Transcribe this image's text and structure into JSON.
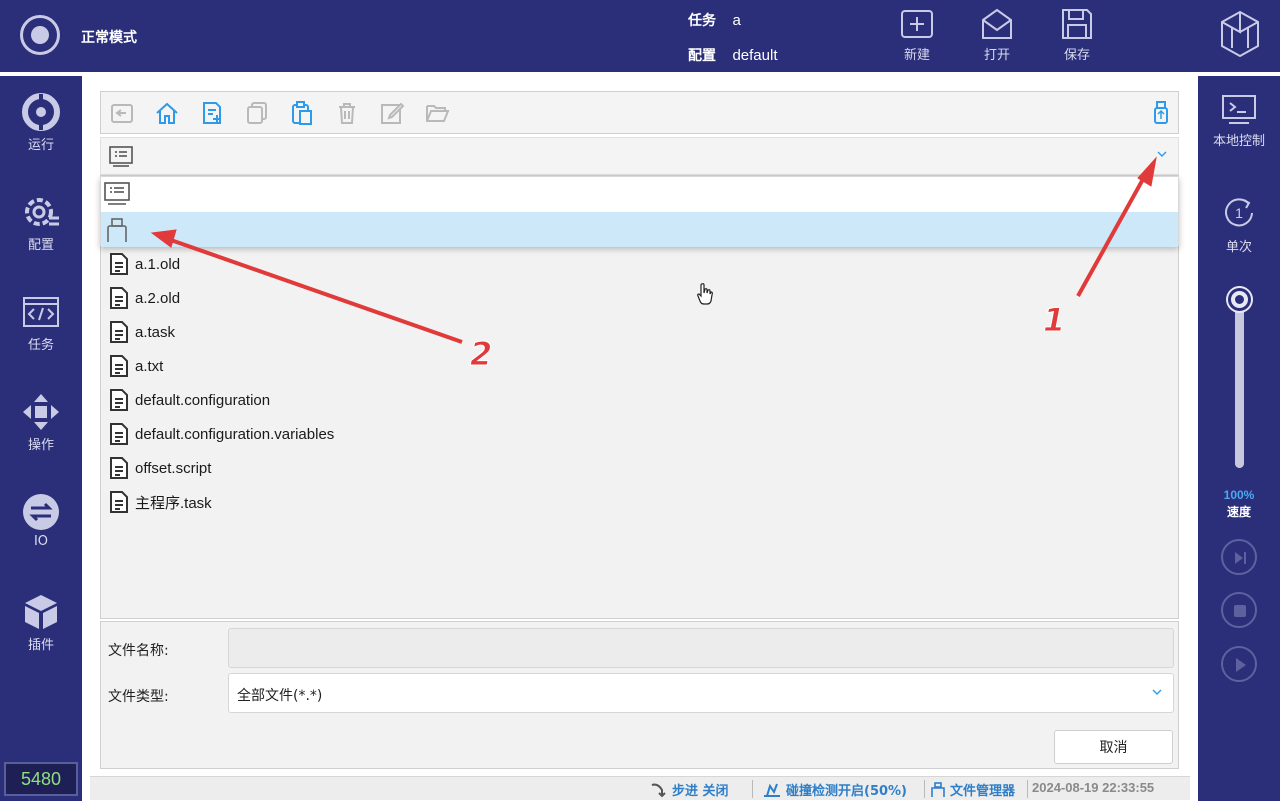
{
  "topbar": {
    "mode_label": "正常模式",
    "task_key": "任务",
    "task_value": "a",
    "config_key": "配置",
    "config_value": "default",
    "new_label": "新建",
    "open_label": "打开",
    "save_label": "保存"
  },
  "left_nav": {
    "run": "运行",
    "config": "配置",
    "task": "任务",
    "operate": "操作",
    "io": "IO",
    "plugin": "插件",
    "counter": "5480"
  },
  "right_nav": {
    "local_control": "本地控制",
    "single": "单次",
    "single_num": "1",
    "speed_value": "100%",
    "speed_fraction": 1.0,
    "speed_label": "速度"
  },
  "files": [
    "a.1.old",
    "a.2.old",
    "a.task",
    "a.txt",
    "default.configuration",
    "default.configuration.variables",
    "offset.script",
    "主程序.task"
  ],
  "form": {
    "name_label": "文件名称:",
    "name_value": "",
    "type_label": "文件类型:",
    "type_value": "全部文件(*.*)",
    "cancel": "取消"
  },
  "status": {
    "step": "步进 关闭",
    "collision": "碰撞检测开启(50%)",
    "file_manager": "文件管理器",
    "time": "2024-08-19 22:33:55"
  },
  "annotations": {
    "one": "1",
    "two": "2",
    "color": "#e03a3a"
  },
  "colors": {
    "nav_bg": "#2b2f7a",
    "accent": "#2f9be8",
    "selection": "#cde8f8"
  }
}
